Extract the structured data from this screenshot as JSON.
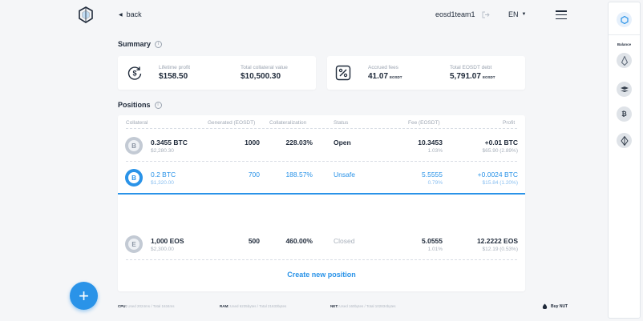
{
  "header": {
    "back_label": "back",
    "account_name": "eosd1team1",
    "language": "EN"
  },
  "summary": {
    "title": "Summary",
    "info_icon": "i",
    "cards": [
      {
        "label": "Lifetime profit",
        "value": "$158.50",
        "icon": "dollar-refresh-icon"
      },
      {
        "label": "Total collateral value",
        "value": "$10,500.30"
      },
      {
        "label": "Accrued fees",
        "value": "41.07",
        "unit": "EOSDT",
        "icon": "percent-tag-icon"
      },
      {
        "label": "Total EOSDT debt",
        "value": "5,791.07",
        "unit": "EOSDT"
      }
    ]
  },
  "positions": {
    "title": "Positions",
    "info_icon": "i",
    "columns": [
      "Collateral",
      "Generated (EOSDT)",
      "Collateralization",
      "Status",
      "Fee (EOSDT)",
      "Profit"
    ],
    "rows": [
      {
        "coin": "B",
        "collateral": "0.3455 BTC",
        "collateral_usd": "$2,280.30",
        "generated": "1000",
        "collateralization": "228.03%",
        "status": "Open",
        "fee": "10.3453",
        "fee_pct": "1.03%",
        "profit": "+0.01 BTC",
        "profit_sub": "$65.90 (2.89%)"
      },
      {
        "coin": "B",
        "collateral": "0.2 BTC",
        "collateral_usd": "$1,320.00",
        "generated": "700",
        "collateralization": "188.57%",
        "status": "Unsafe",
        "fee": "5.5555",
        "fee_pct": "0.79%",
        "profit": "+0.0024 BTC",
        "profit_sub": "$15.84 (1.20%)"
      },
      {
        "coin": "E",
        "collateral": "1,000 EOS",
        "collateral_usd": "$2,300.00",
        "generated": "500",
        "collateralization": "460.00%",
        "status": "Closed",
        "fee": "5.0555",
        "fee_pct": "1.01%",
        "profit": "12.2222 EOS",
        "profit_sub": "$12.19 (0.53%)"
      }
    ],
    "create_label": "Create new position"
  },
  "fab_label": "+",
  "footer": {
    "cpu_label": "CPU:",
    "cpu_value": "Used 2024ms / Total 1634ms",
    "ram_label": "RAM:",
    "ram_value": "Used 6235bytes / Total 21633bytes",
    "net_label": "NET:",
    "net_value": "Used 160bytes / Total 102834bytes",
    "buy_label": "Buy NUT"
  },
  "side_panel": {
    "balance_label": "Balance",
    "tokens": [
      "eos-token-icon",
      "eosdt-token-icon",
      "btc-token-icon",
      "nut-token-icon"
    ]
  },
  "colors": {
    "accent": "#2a93e8",
    "text": "#1f2a3a",
    "muted": "#9aa3b0",
    "background": "#f5f6f8"
  }
}
